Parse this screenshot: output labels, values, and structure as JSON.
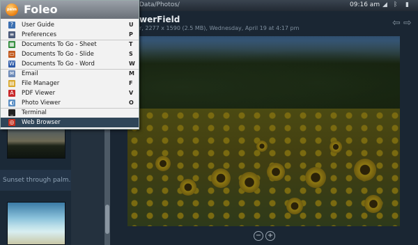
{
  "topbar": {
    "path": "Data/Photos/",
    "time": "09:16 am",
    "status_icons": [
      "signal-icon",
      "bluetooth-icon",
      "battery-icon"
    ]
  },
  "viewer": {
    "title": "werField",
    "info": "r, 2277 x 1590 (2.5 MB), Wednesday, April 19 at 4:17 pm",
    "zoom_out": "−",
    "zoom_in": "+"
  },
  "sidebar": {
    "caption": "Sunset through palm..."
  },
  "menu": {
    "brand": "Foleo",
    "logo_text": "palm",
    "items": [
      {
        "label": "User Guide",
        "key": "U",
        "icon": "user-guide-icon",
        "color": "#3b6fb0",
        "glyph": "?"
      },
      {
        "label": "Preferences",
        "key": "P",
        "icon": "preferences-icon",
        "color": "#4a5a7a",
        "glyph": "≡"
      },
      {
        "label": "Documents To Go - Sheet",
        "key": "T",
        "icon": "sheet-icon",
        "color": "#2f8a3a",
        "glyph": "▦"
      },
      {
        "label": "Documents To Go - Slide",
        "key": "S",
        "icon": "slide-icon",
        "color": "#c25a1e",
        "glyph": "▭"
      },
      {
        "label": "Documents To Go - Word",
        "key": "W",
        "icon": "word-icon",
        "color": "#2d5aa8",
        "glyph": "W"
      },
      {
        "label": "Email",
        "key": "M",
        "icon": "email-icon",
        "color": "#6c8ab8",
        "glyph": "✉"
      },
      {
        "label": "File Manager",
        "key": "F",
        "icon": "file-manager-icon",
        "color": "#d9a72a",
        "glyph": "▤"
      },
      {
        "label": "PDF Viewer",
        "key": "V",
        "icon": "pdf-icon",
        "color": "#c8282a",
        "glyph": "A"
      },
      {
        "label": "Photo Viewer",
        "key": "O",
        "icon": "photo-viewer-icon",
        "color": "#5c8fc4",
        "glyph": "◐"
      },
      {
        "label": "Terminal",
        "key": "",
        "icon": "terminal-icon",
        "color": "#222222",
        "glyph": "_"
      },
      {
        "label": "Web Browser",
        "key": "",
        "icon": "web-browser-icon",
        "color": "#c23020",
        "glyph": "◎"
      }
    ]
  }
}
